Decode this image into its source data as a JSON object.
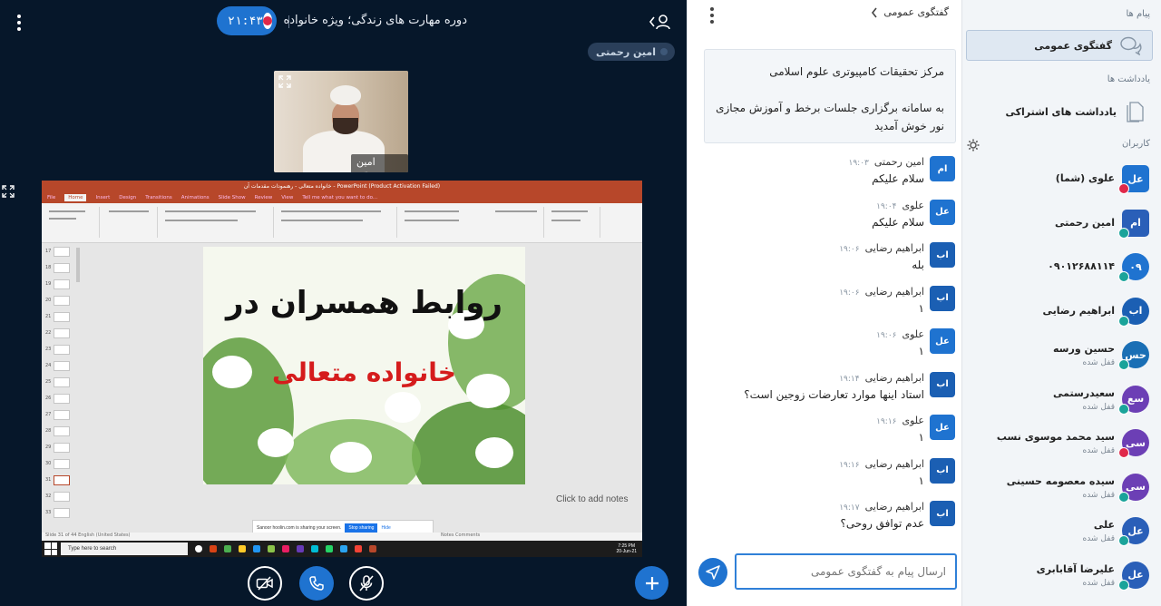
{
  "header": {
    "meeting_title": "دوره مهارت های زندگی؛ ویژه خانواده",
    "record_time": "۲۱:۴۳"
  },
  "talking_indicator": {
    "name": "امین رحمتی"
  },
  "webcam": {
    "name": "امین رحمتی"
  },
  "presentation": {
    "app_title": "خانواده متعالی - رهنمودات مقدمات آن - PowerPoint (Product Activation Failed)",
    "ribbon_tabs": [
      "File",
      "Home",
      "Insert",
      "Design",
      "Transitions",
      "Animations",
      "Slide Show",
      "Review",
      "View",
      "Tell me what you want to do..."
    ],
    "thumb_numbers": [
      "17",
      "18",
      "19",
      "20",
      "21",
      "22",
      "23",
      "24",
      "25",
      "26",
      "27",
      "28",
      "29",
      "30",
      "31",
      "32",
      "33"
    ],
    "slide_title_line1": "روابط همسران در",
    "slide_title_line2": "خانواده متعالی",
    "notes_placeholder": "Click to add notes",
    "share_banner_text": "Sanoor hoolin.com is sharing your screen.",
    "share_stop": "Stop sharing",
    "share_hide": "Hide",
    "status_left": "Slide 31 of 44   English (United States)",
    "status_right": "Notes   Comments",
    "taskbar_search": "Type here to search",
    "clock_time": "7:25 PM",
    "clock_date": "20-Jun-21"
  },
  "controls": {
    "camera": "camera-off",
    "phone": "leave-audio",
    "mic": "mic-off",
    "plus": "actions"
  },
  "chat": {
    "title": "گفتگوی عمومی",
    "welcome_line1": "مرکز تحقیقات کامپیوتری علوم اسلامی",
    "welcome_line2": "به سامانه برگزاری جلسات برخط و آموزش مجازی نور خوش آمدید",
    "messages": [
      {
        "avatar": "ام",
        "name": "امین رحمتی",
        "time": "۱۹:۰۳",
        "text": "سلام علیکم"
      },
      {
        "avatar": "عل",
        "name": "علوی",
        "time": "۱۹:۰۴",
        "text": "سلام علیکم"
      },
      {
        "avatar": "اب",
        "name": "ابراهیم رضایی",
        "time": "۱۹:۰۶",
        "text": "بله"
      },
      {
        "avatar": "اب",
        "name": "ابراهیم رضایی",
        "time": "۱۹:۰۶",
        "text": "۱"
      },
      {
        "avatar": "عل",
        "name": "علوی",
        "time": "۱۹:۰۶",
        "text": "۱"
      },
      {
        "avatar": "اب",
        "name": "ابراهیم رضایی",
        "time": "۱۹:۱۴",
        "text": "استاد اینها موارد تعارضات زوجین است؟"
      },
      {
        "avatar": "عل",
        "name": "علوی",
        "time": "۱۹:۱۶",
        "text": "۱"
      },
      {
        "avatar": "اب",
        "name": "ابراهیم رضایی",
        "time": "۱۹:۱۶",
        "text": "۱"
      },
      {
        "avatar": "اب",
        "name": "ابراهیم رضایی",
        "time": "۱۹:۱۷",
        "text": "عدم توافق روحی؟"
      }
    ],
    "input_placeholder": "ارسال پیام به گفتگوی عمومی"
  },
  "sidebar": {
    "messages_label": "پیام ها",
    "public_chat_label": "گفتگوی عمومی",
    "notes_label": "یادداشت ها",
    "shared_notes_label": "یادداشت های اشتراکی",
    "users_label": "کاربران",
    "users": [
      {
        "avatar": "عل",
        "name": "علوی (شما)",
        "status": "",
        "color": "#1f73d0",
        "badge": "#e0284a",
        "square": true
      },
      {
        "avatar": "ام",
        "name": "امین رحمتی",
        "status": "",
        "color": "#2a5fb8",
        "badge": "#1aa39a",
        "square": true
      },
      {
        "avatar": "۰۹",
        "name": "۰۹۰۱۲۶۸۸۱۱۴",
        "status": "",
        "color": "#1f73d0",
        "badge": "#1aa39a",
        "square": false
      },
      {
        "avatar": "اب",
        "name": "ابراهیم رضایی",
        "status": "",
        "color": "#1b5fb3",
        "badge": "#1aa39a",
        "square": false
      },
      {
        "avatar": "حس",
        "name": "حسین ورسه",
        "status": "قفل شده",
        "color": "#1a6fb5",
        "badge": "#1aa39a",
        "square": false
      },
      {
        "avatar": "سع",
        "name": "سعیدرستمی",
        "status": "قفل شده",
        "color": "#6c3fb5",
        "badge": "#1aa39a",
        "square": false
      },
      {
        "avatar": "سی",
        "name": "سید محمد موسوی نسب",
        "status": "قفل شده",
        "color": "#6c3fb5",
        "badge": "#e0284a",
        "square": false
      },
      {
        "avatar": "سی",
        "name": "سیده معصومه حسینی",
        "status": "قفل شده",
        "color": "#6c3fb5",
        "badge": "#1aa39a",
        "square": false
      },
      {
        "avatar": "عل",
        "name": "علی",
        "status": "قفل شده",
        "color": "#2a5fb8",
        "badge": "#1aa39a",
        "square": false
      },
      {
        "avatar": "عل",
        "name": "علیرضا آقابابری",
        "status": "قفل شده",
        "color": "#2a5fb8",
        "badge": "#1aa39a",
        "square": false
      }
    ]
  },
  "colors": {
    "accent": "#1f73d0",
    "main_bg": "#06172a",
    "ppt_red": "#b7472a",
    "slide_red": "#d51c1c"
  }
}
